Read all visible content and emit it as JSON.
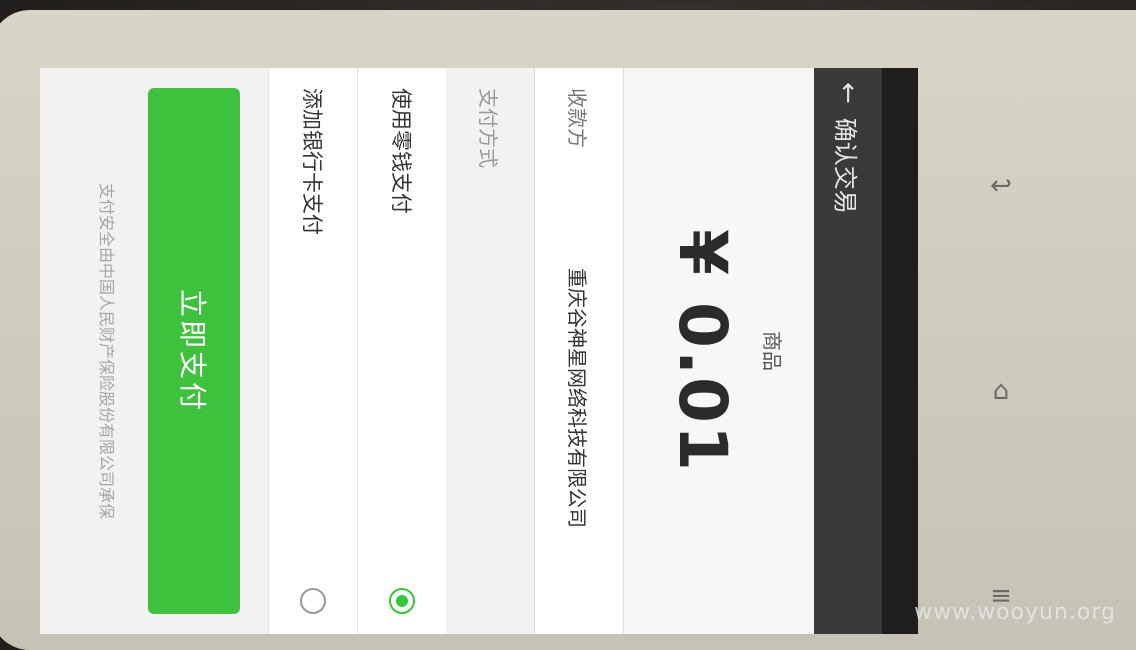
{
  "status_bar": {
    "carrier": "",
    "time": ""
  },
  "action_bar": {
    "back_glyph": "←",
    "title": "确认交易"
  },
  "summary": {
    "item_label": "商品",
    "amount": "¥ 0.01"
  },
  "payee": {
    "label": "收款方",
    "value": "重庆谷神星网络科技有限公司"
  },
  "payment": {
    "section_title": "支付方式",
    "methods": [
      {
        "label": "使用零钱支付",
        "selected": true
      },
      {
        "label": "添加银行卡支付",
        "selected": false
      }
    ]
  },
  "pay_button": {
    "label": "立即支付"
  },
  "footer": {
    "text": "支付安全由中国人民财产保险股份有限公司承保"
  },
  "watermark": "www.wooyun.org",
  "hardware_keys": {
    "back": "↩",
    "home": "⌂",
    "menu": "≡"
  },
  "colors": {
    "accent": "#3ec23e",
    "radio_checked": "#34c73a"
  }
}
